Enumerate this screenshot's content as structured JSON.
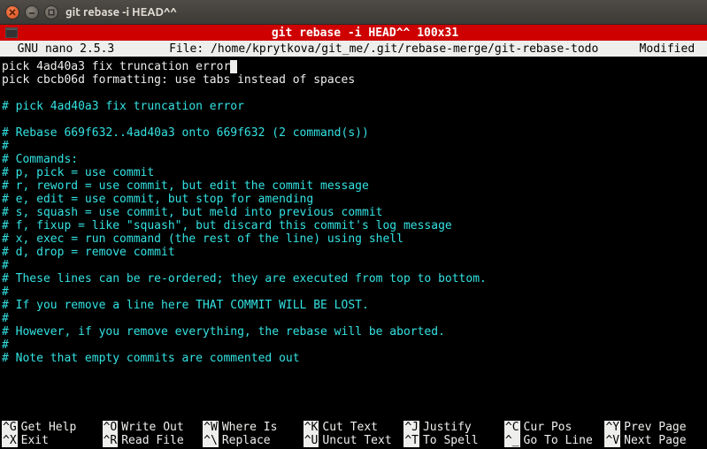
{
  "window": {
    "title": "git rebase -i HEAD^^"
  },
  "tab": {
    "label": "git rebase -i HEAD^^ 100x31"
  },
  "nano": {
    "version": "  GNU nano 2.5.3  ",
    "file": "File: /home/kprytkova/git_me/.git/rebase-merge/git-rebase-todo",
    "modified": "Modified "
  },
  "editor": {
    "lines": [
      {
        "text": "pick 4ad40a3 fix truncation error",
        "comment": false,
        "cursor": true
      },
      {
        "text": "pick cbcb06d formatting: use tabs instead of spaces",
        "comment": false
      },
      {
        "text": "",
        "comment": false
      },
      {
        "text": "# pick 4ad40a3 fix truncation error",
        "comment": true
      },
      {
        "text": "",
        "comment": false
      },
      {
        "text": "# Rebase 669f632..4ad40a3 onto 669f632 (2 command(s))",
        "comment": true
      },
      {
        "text": "#",
        "comment": true
      },
      {
        "text": "# Commands:",
        "comment": true
      },
      {
        "text": "# p, pick = use commit",
        "comment": true
      },
      {
        "text": "# r, reword = use commit, but edit the commit message",
        "comment": true
      },
      {
        "text": "# e, edit = use commit, but stop for amending",
        "comment": true
      },
      {
        "text": "# s, squash = use commit, but meld into previous commit",
        "comment": true
      },
      {
        "text": "# f, fixup = like \"squash\", but discard this commit's log message",
        "comment": true
      },
      {
        "text": "# x, exec = run command (the rest of the line) using shell",
        "comment": true
      },
      {
        "text": "# d, drop = remove commit",
        "comment": true
      },
      {
        "text": "#",
        "comment": true
      },
      {
        "text": "# These lines can be re-ordered; they are executed from top to bottom.",
        "comment": true
      },
      {
        "text": "#",
        "comment": true
      },
      {
        "text": "# If you remove a line here THAT COMMIT WILL BE LOST.",
        "comment": true
      },
      {
        "text": "#",
        "comment": true
      },
      {
        "text": "# However, if you remove everything, the rebase will be aborted.",
        "comment": true
      },
      {
        "text": "#",
        "comment": true
      },
      {
        "text": "# Note that empty commits are commented out",
        "comment": true
      }
    ]
  },
  "shortcuts": {
    "rows": [
      [
        {
          "key": "^G",
          "label": "Get Help"
        },
        {
          "key": "^O",
          "label": "Write Out"
        },
        {
          "key": "^W",
          "label": "Where Is"
        },
        {
          "key": "^K",
          "label": "Cut Text"
        },
        {
          "key": "^J",
          "label": "Justify"
        },
        {
          "key": "^C",
          "label": "Cur Pos"
        },
        {
          "key": "^Y",
          "label": "Prev Page"
        }
      ],
      [
        {
          "key": "^X",
          "label": "Exit"
        },
        {
          "key": "^R",
          "label": "Read File"
        },
        {
          "key": "^\\",
          "label": "Replace"
        },
        {
          "key": "^U",
          "label": "Uncut Text"
        },
        {
          "key": "^T",
          "label": "To Spell"
        },
        {
          "key": "^_",
          "label": "Go To Line"
        },
        {
          "key": "^V",
          "label": "Next Page"
        }
      ]
    ]
  }
}
